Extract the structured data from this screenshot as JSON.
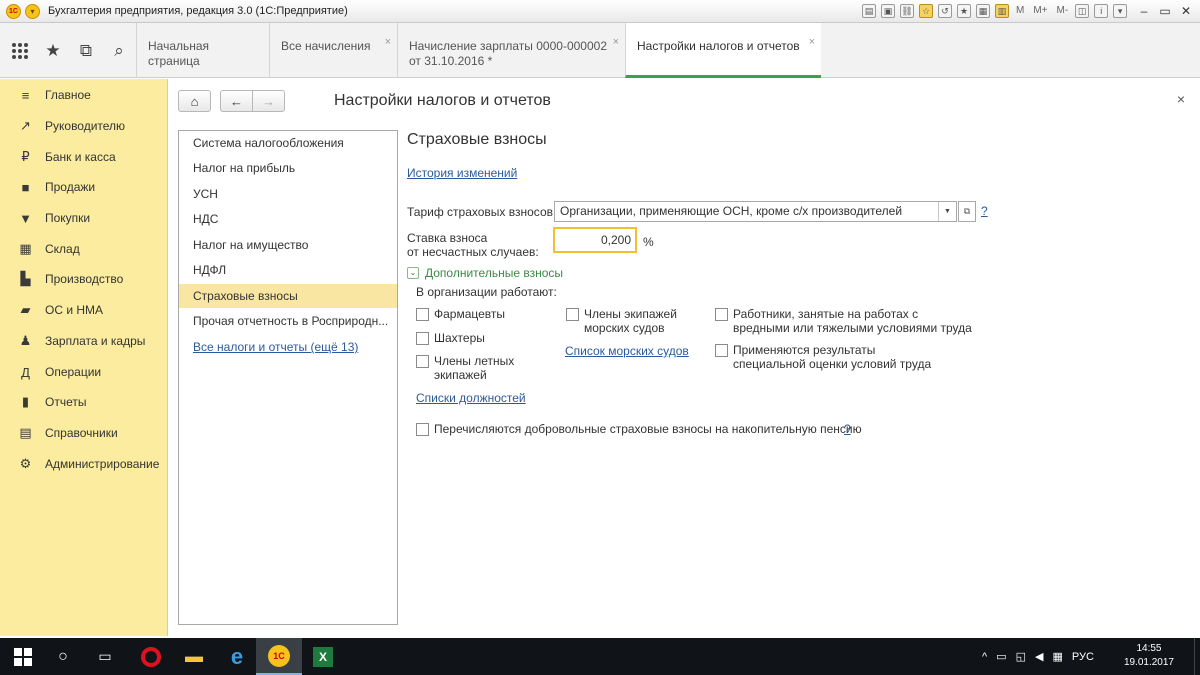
{
  "window": {
    "title": "Бухгалтерия предприятия, редакция 3.0  (1С:Предприятие)",
    "logo_text": "1С",
    "mem_buttons": [
      "M",
      "M+",
      "M-"
    ]
  },
  "tabs": [
    {
      "label": "Начальная страница",
      "closable": false
    },
    {
      "label": "Все начисления",
      "closable": true
    },
    {
      "label": "Начисление зарплаты 0000-000002 от 31.10.2016 *",
      "closable": true
    },
    {
      "label": "Настройки налогов и отчетов",
      "closable": true,
      "active": true
    }
  ],
  "sidebar": {
    "items": [
      {
        "icon": "menu-icon",
        "label": "Главное"
      },
      {
        "icon": "trend-icon",
        "label": "Руководителю"
      },
      {
        "icon": "ruble-icon",
        "label": "Банк и касса"
      },
      {
        "icon": "bag-icon",
        "label": "Продажи"
      },
      {
        "icon": "cart-icon",
        "label": "Покупки"
      },
      {
        "icon": "warehouse-icon",
        "label": "Склад"
      },
      {
        "icon": "factory-icon",
        "label": "Производство"
      },
      {
        "icon": "assets-icon",
        "label": "ОС и НМА"
      },
      {
        "icon": "people-icon",
        "label": "Зарплата и кадры"
      },
      {
        "icon": "operations-icon",
        "label": "Операции"
      },
      {
        "icon": "chart-icon",
        "label": "Отчеты"
      },
      {
        "icon": "book-icon",
        "label": "Справочники"
      },
      {
        "icon": "gear-icon",
        "label": "Администрирование"
      }
    ]
  },
  "page": {
    "title": "Настройки налогов и отчетов",
    "nav_items": [
      {
        "label": "Система налогообложения"
      },
      {
        "label": "Налог на прибыль"
      },
      {
        "label": "УСН"
      },
      {
        "label": "НДС"
      },
      {
        "label": "Налог на имущество"
      },
      {
        "label": "НДФЛ"
      },
      {
        "label": "Страховые взносы",
        "active": true
      },
      {
        "label": "Прочая отчетность в Росприродн..."
      },
      {
        "label": "Все налоги и отчеты (ещё 13)",
        "link": true
      }
    ]
  },
  "section": {
    "title": "Страховые взносы",
    "history_link": "История изменений",
    "tariff_label": "Тариф страховых взносов:",
    "tariff_value": "Организации, применяющие ОСН, кроме с/х производителей",
    "help": "?",
    "rate_label_1": "Ставка взноса",
    "rate_label_2": "от несчастных случаев:",
    "rate_value": "0,200",
    "rate_unit": "%",
    "additional_title": "Дополнительные взносы",
    "workers_label": "В организации работают:",
    "checkboxes": {
      "pharmacists": "Фармацевты",
      "miners": "Шахтеры",
      "flight_crew_1": "Члены летных",
      "flight_crew_2": "экипажей",
      "ship_crew_1": "Члены экипажей",
      "ship_crew_2": "морских судов",
      "hazard_1": "Работники, занятые на работах с",
      "hazard_2": "вредными или тяжелыми условиями труда",
      "assessment_1": "Применяются результаты",
      "assessment_2": "специальной оценки условий труда",
      "voluntary": "Перечисляются добровольные страховые взносы на накопительную пенсию"
    },
    "ships_link": "Список морских судов",
    "positions_link": "Списки должностей"
  },
  "taskbar": {
    "lang": "РУС",
    "time": "14:55",
    "date": "19.01.2017",
    "excel_letter": "X",
    "opera_letter": "O",
    "ie_letter": "e",
    "onec_letter": "1С"
  }
}
